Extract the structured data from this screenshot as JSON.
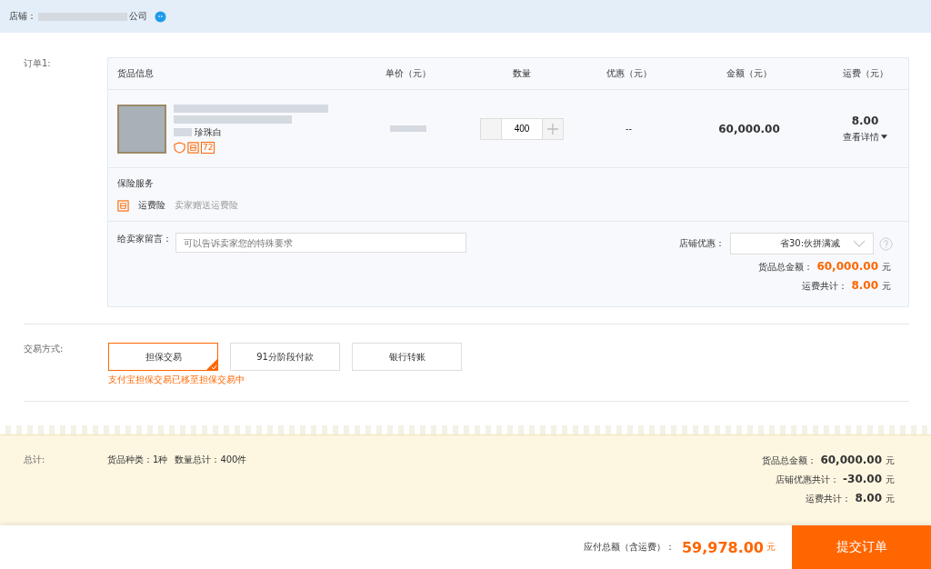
{
  "store": {
    "label": "店铺：",
    "name": "公司"
  },
  "order": {
    "label": "订单1:",
    "columns": [
      "货品信息",
      "单价（元）",
      "数量",
      "优惠（元）",
      "金额（元）",
      "运费（元）"
    ],
    "item": {
      "variant": "珍珠白",
      "badge": "72",
      "quantity": "400",
      "discount": "--",
      "amount": "60,000.00",
      "shipping": "8.00",
      "details_link": "查看详情"
    },
    "insurance": {
      "title": "保险服务",
      "name": "运费险",
      "note": "卖家赠送运费险"
    },
    "message": {
      "label": "给卖家留言：",
      "placeholder": "可以告诉卖家您的特殊要求"
    },
    "store_discount": {
      "label": "店铺优惠：",
      "value": "省30:伙拼满减"
    },
    "goods_total": {
      "label": "货品总金额：",
      "value": "60,000.00",
      "unit": "元"
    },
    "shipping_total": {
      "label": "运费共计：",
      "value": "8.00",
      "unit": "元"
    }
  },
  "payment": {
    "label": "交易方式:",
    "options": [
      {
        "label": "担保交易",
        "selected": true
      },
      {
        "label": "91分阶段付款",
        "selected": false
      },
      {
        "label": "银行转账",
        "selected": false
      }
    ],
    "notice": "支付宝担保交易已移至担保交易中"
  },
  "summary": {
    "label": "总计:",
    "kinds": "货品种类：1种",
    "count": "数量总计：400件",
    "lines": [
      {
        "label": "货品总金额：",
        "value": "60,000.00",
        "unit": "元"
      },
      {
        "label": "店铺优惠共计：",
        "value": "-30.00",
        "unit": "元"
      },
      {
        "label": "运费共计：",
        "value": "8.00",
        "unit": "元"
      }
    ]
  },
  "footer": {
    "label": "应付总额（含运费）：",
    "value": "59,978.00",
    "unit": "元",
    "submit": "提交订单"
  }
}
